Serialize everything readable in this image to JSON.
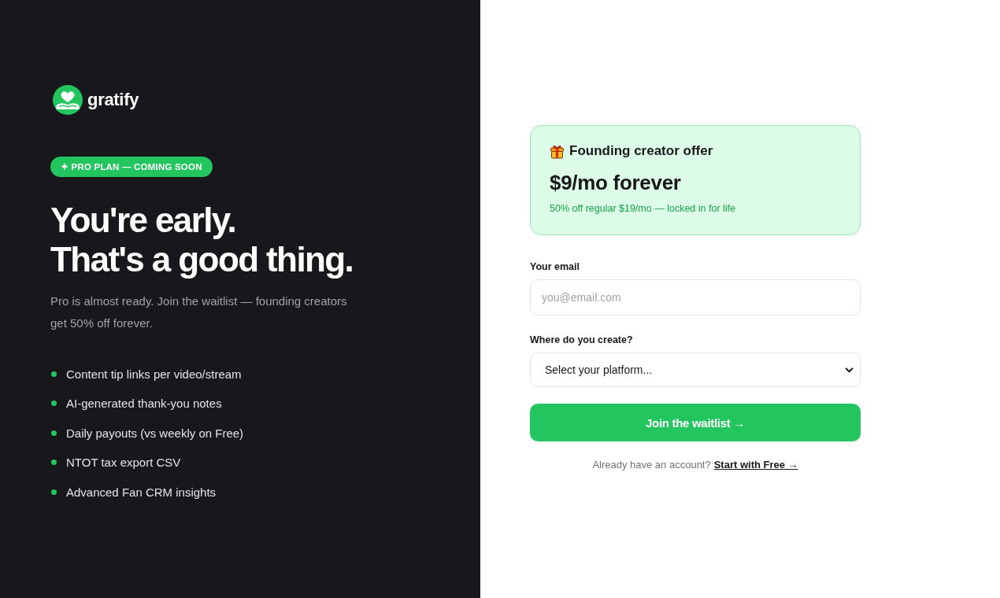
{
  "brand": {
    "name": "gratify"
  },
  "badge": "✦ PRO PLAN — COMING SOON",
  "headline": [
    "You're early.",
    "That's a good thing."
  ],
  "intro": "Pro is almost ready. Join the waitlist — founding creators get 50% off forever.",
  "features": [
    "Content tip links per video/stream",
    "AI-generated thank-you notes",
    "Daily payouts (vs weekly on Free)",
    "NTOT tax export CSV",
    "Advanced Fan CRM insights"
  ],
  "offer": {
    "title": "Founding creator offer",
    "price": "$9/mo forever",
    "note": "50% off regular $19/mo — locked in for life"
  },
  "form": {
    "fields": [
      {
        "kind": "input",
        "label": "Your email",
        "placeholder": "you@email.com"
      },
      {
        "kind": "select",
        "label": "Where do you create?",
        "value": "Select your platform..."
      }
    ],
    "submit": "Join the waitlist →",
    "footer": {
      "text": "Already have an account?",
      "link": "Start with Free →"
    }
  }
}
